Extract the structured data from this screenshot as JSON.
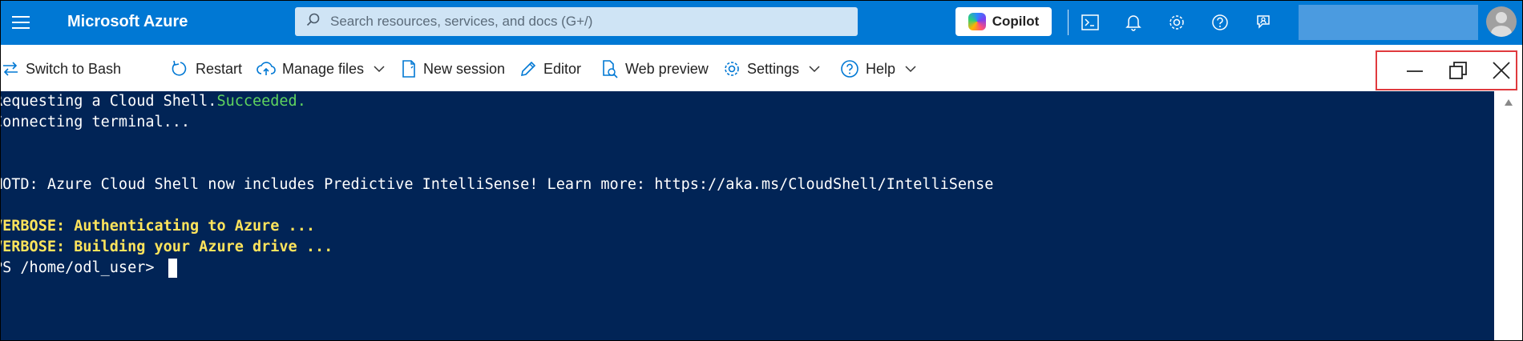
{
  "header": {
    "brand": "Microsoft Azure",
    "search_placeholder": "Search resources, services, and docs (G+/)",
    "copilot_label": "Copilot",
    "icons": [
      "cloud-shell-icon",
      "notifications-icon",
      "settings-icon",
      "help-icon",
      "feedback-icon"
    ]
  },
  "panel_handle": "...",
  "toolbar": {
    "switch_to_bash": "Switch to Bash",
    "restart": "Restart",
    "manage_files": "Manage files",
    "new_session": "New session",
    "editor": "Editor",
    "web_preview": "Web preview",
    "settings": "Settings",
    "help": "Help"
  },
  "window_controls": [
    "minimize-icon",
    "restore-icon",
    "close-icon"
  ],
  "terminal": {
    "line1_prefix": "Requesting a Cloud Shell.",
    "line1_status": "Succeeded.",
    "line2": "Connecting terminal...",
    "motd": "MOTD: Azure Cloud Shell now includes Predictive IntelliSense! Learn more: https://aka.ms/CloudShell/IntelliSense",
    "verbose1": "VERBOSE: Authenticating to Azure ...",
    "verbose2": "VERBOSE: Building your Azure drive ...",
    "prompt": "PS /home/odl_user> "
  },
  "colors": {
    "azure_blue": "#0078d4",
    "terminal_bg": "#012456",
    "success_green": "#5fd35f",
    "verbose_yellow": "#ffe45c",
    "highlight_red": "#e03a3e"
  }
}
